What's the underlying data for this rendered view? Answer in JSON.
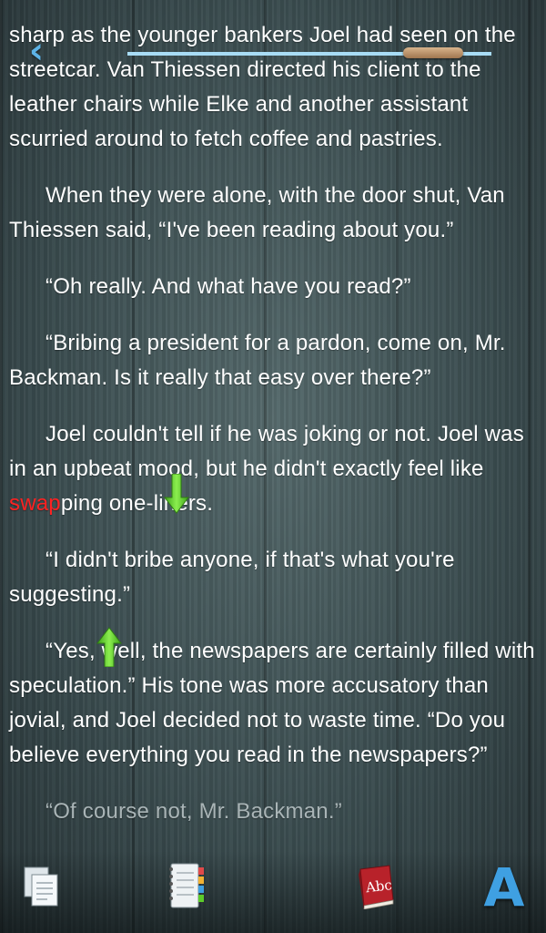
{
  "navigation": {
    "back_label": "‹",
    "progress_fraction": 0.84
  },
  "book": {
    "paragraphs": [
      {
        "text": "sharp as the younger bankers Joel had seen on the streetcar. Van Thiessen directed his client to the leather chairs while Elke and another assistant scurried around to fetch coffee and pastries."
      },
      {
        "text": "When they were alone, with the door shut, Van Thiessen said, “I've been reading about you.”"
      },
      {
        "text": "“Oh really. And what have you read?”"
      },
      {
        "text": "“Bribing a president for a pardon, come on, Mr. Backman. Is it really that easy over there?”"
      },
      {
        "before": "Joel couldn't tell if he was joking or not. Joel was in an upbeat mood, but he didn't exactly feel like ",
        "highlight": "swap",
        "after": "ping one-liners."
      },
      {
        "text": "“I didn't bribe anyone, if that's what you're suggesting.”"
      },
      {
        "text": "“Yes, well, the newspapers are certainly filled with speculation.” His tone was more accusatory than jovial, and Joel decided not to waste time. “Do you believe everything you read in the newspapers?”"
      },
      {
        "text": "“Of course not, Mr. Backman.”"
      }
    ],
    "highlight_color": "#ff2222"
  },
  "toolbar": {
    "pages_icon": "pages-icon",
    "contents_icon": "notebook-icon",
    "dictionary_icon": "dictionary-book-icon",
    "dictionary_label": "Abc",
    "font_label": "A"
  },
  "colors": {
    "accent": "#3fa0e2",
    "progress_track": "#a8dcf5",
    "handle_green": "#5ccc2a"
  }
}
